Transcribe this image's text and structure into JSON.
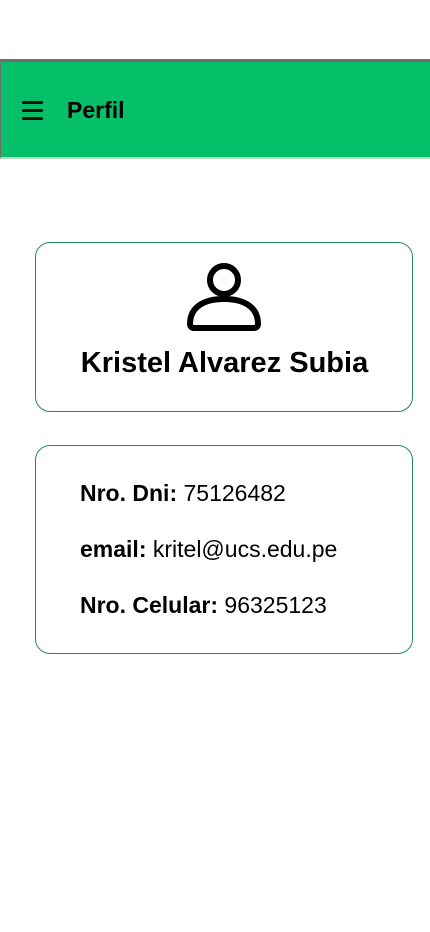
{
  "header": {
    "title": "Perfil",
    "menu_icon": "hamburger-menu-icon",
    "background_color": "#05c069"
  },
  "profile": {
    "avatar_icon": "user-icon",
    "name": "Kristel Alvarez Subia"
  },
  "details": {
    "dni_label": "Nro. Dni:",
    "dni_value": "75126482",
    "email_label": "email:",
    "email_value": "kritel@ucs.edu.pe",
    "phone_label": "Nro. Celular:",
    "phone_value": "96325123"
  },
  "colors": {
    "accent": "#05c069",
    "card_border": "#248b55"
  }
}
